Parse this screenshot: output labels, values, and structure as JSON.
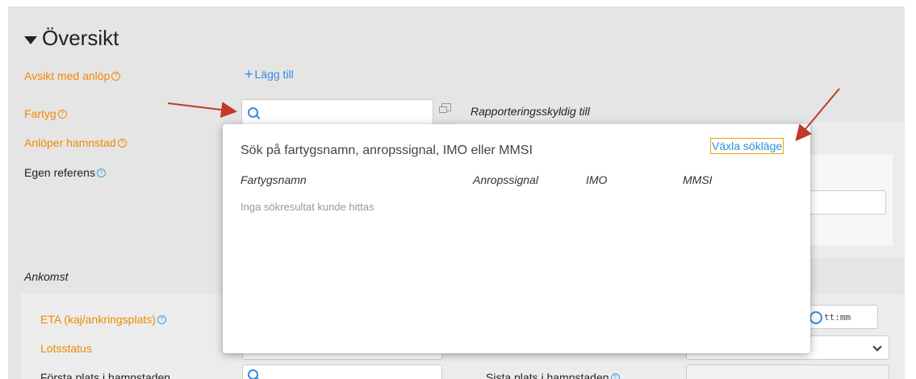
{
  "section": {
    "title": "Översikt"
  },
  "fields": {
    "avsikt": {
      "label": "Avsikt med anlöp",
      "add_label": "Lägg till"
    },
    "fartyg": {
      "label": "Fartyg",
      "search_value": ""
    },
    "anloper": {
      "label": "Anlöper hamnstad"
    },
    "egen_referens": {
      "label": "Egen referens"
    },
    "rapporteringsskyldig": {
      "label": "Rapporteringsskyldig till"
    }
  },
  "ankomst": {
    "title": "Ankomst",
    "eta_label": "ETA (kaj/ankringsplats)",
    "lotsstatus_label": "Lotsstatus",
    "forsta_plats_label": "Första plats i hamnstaden",
    "sista_plats_label": "Sista plats i hamnstaden",
    "time_placeholder": "tt:mm"
  },
  "popup": {
    "title": "Sök på fartygsnamn, anropssignal, IMO eller MMSI",
    "toggle_label": "Växla sökläge",
    "columns": [
      "Fartygsnamn",
      "Anropssignal",
      "IMO",
      "MMSI"
    ],
    "empty_message": "Inga sökresultat kunde hittas"
  },
  "colors": {
    "accent_orange": "#f08a00",
    "link_blue": "#2e8ee0",
    "arrow_red": "#c0392b"
  }
}
